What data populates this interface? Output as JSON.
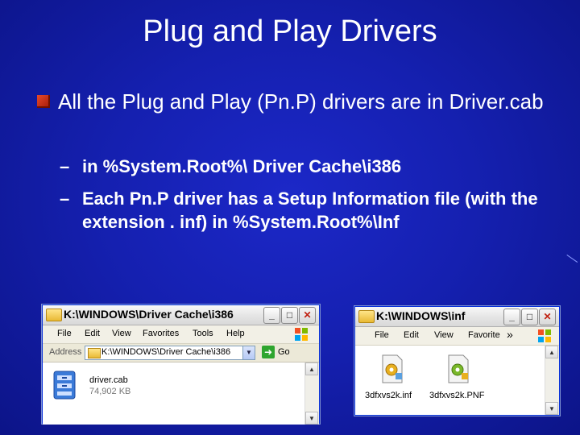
{
  "slide": {
    "title": "Plug and Play Drivers",
    "bullet": "All the Plug and Play (Pn.P) drivers are in Driver.cab",
    "sub_bullets": [
      "in %System.Root%\\ Driver Cache\\i386",
      "Each Pn.P driver has a Setup Information file (with the extension . inf) in %System.Root%\\Inf"
    ],
    "dash": "–"
  },
  "window1": {
    "title": "K:\\WINDOWS\\Driver Cache\\i386",
    "menu": [
      "File",
      "Edit",
      "View",
      "Favorites",
      "Tools",
      "Help"
    ],
    "address_label": "Address",
    "address_value": "K:\\WINDOWS\\Driver Cache\\i386",
    "go_label": "Go",
    "file": {
      "name": "driver.cab",
      "size": "74,902 KB",
      "icon": "cabinet-file-icon"
    },
    "buttons": {
      "minimize": "_",
      "maximize": "□",
      "close": "✕"
    }
  },
  "window2": {
    "title": "K:\\WINDOWS\\inf",
    "menu": [
      "File",
      "Edit",
      "View",
      "Favorite"
    ],
    "chevron": "»",
    "files": [
      {
        "name": "3dfxvs2k.inf",
        "icon": "setup-info-file-icon"
      },
      {
        "name": "3dfxvs2k.PNF",
        "icon": "precompiled-info-file-icon"
      }
    ],
    "buttons": {
      "minimize": "_",
      "maximize": "□",
      "close": "✕"
    }
  },
  "colors": {
    "background": "#1520b0",
    "bullet": "#c83018",
    "xp_border": "#0831d9"
  }
}
